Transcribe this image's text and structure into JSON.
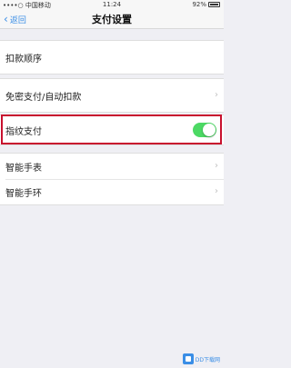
{
  "status_bar": {
    "carrier": "••••○ 中国移动 ",
    "time": "11:24",
    "battery": "92%"
  },
  "nav": {
    "back_label": "返回",
    "title": "支付设置"
  },
  "sections": [
    {
      "items": [
        {
          "label": "扣款顺序"
        }
      ]
    },
    {
      "items": [
        {
          "label": "免密支付/自动扣款"
        }
      ]
    },
    {
      "items": [
        {
          "label": "指纹支付",
          "toggle": true
        }
      ]
    },
    {
      "items": [
        {
          "label": "智能手表"
        },
        {
          "label": "智能手环"
        }
      ]
    }
  ],
  "colors": {
    "accent": "#3a8ee6",
    "toggle_on": "#4cd964",
    "highlight": "#c8112e"
  },
  "watermark": {
    "text": "DD下载网"
  }
}
